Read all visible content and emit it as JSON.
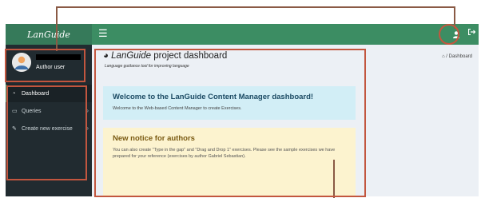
{
  "app": {
    "logo": "LanGuide"
  },
  "header": {
    "menu_icon": "hamburger-icon",
    "user_icon": "user-icon",
    "logout_icon": "logout-icon"
  },
  "sidebar": {
    "user": {
      "role": "Author user"
    },
    "items": [
      {
        "label": "Dashboard",
        "icon": "dashboard-icon",
        "active": true,
        "has_children": false
      },
      {
        "label": "Queries",
        "icon": "monitor-icon",
        "active": false,
        "has_children": true
      },
      {
        "label": "Create new exercise",
        "icon": "edit-icon",
        "active": false,
        "has_children": true
      }
    ]
  },
  "content": {
    "title_brand": "LanGuide",
    "title_rest": " project dashboard",
    "subtitle": "Language guidance tool for improving language",
    "breadcrumb": "Dashboard",
    "welcome": {
      "heading": "Welcome to the LanGuide Content Manager dashboard!",
      "text": "Welcome to the Web-based Content Manager to create Exercises."
    },
    "notice": {
      "heading": "New notice for authors",
      "text": "You can also create \"Type in the gap\" and \"Drag and Drop 1\" exercises. Please see the sample exercises we have prepared for your reference (exercises by author Gabriel Sebastian)."
    }
  },
  "colors": {
    "header": "#3c8d63",
    "logo_bg": "#367a5a",
    "sidebar": "#212b30",
    "annotation": "#c2563f",
    "info_callout": "#d2eef6",
    "warning_callout": "#fcf3cf"
  }
}
